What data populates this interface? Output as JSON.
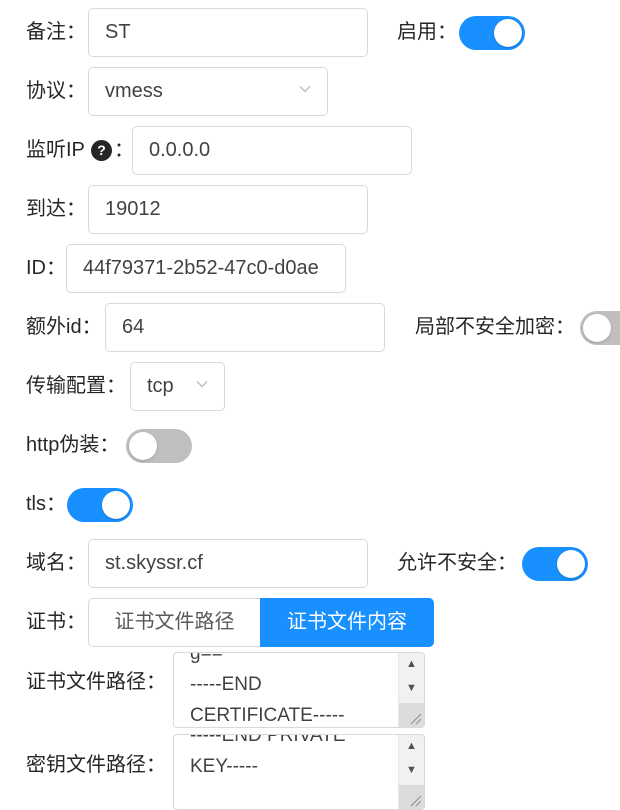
{
  "remark": {
    "label": "备注：",
    "value": "ST"
  },
  "enable": {
    "label": "启用：",
    "on": true
  },
  "protocol": {
    "label": "协议：",
    "value": "vmess"
  },
  "listen_ip": {
    "label_prefix": "监听IP",
    "label_suffix": "：",
    "help_icon": "question-circle-icon",
    "help_glyph": "?",
    "value": "0.0.0.0"
  },
  "port": {
    "label": "到达：",
    "value": "19012"
  },
  "id_field": {
    "label": "ID：",
    "value": "44f79371-2b52-47c0-d0ae"
  },
  "alter_id": {
    "label": "额外id：",
    "value": "64"
  },
  "partial_insecure": {
    "label": "局部不安全加密：",
    "on": false
  },
  "transport": {
    "label": "传输配置：",
    "value": "tcp"
  },
  "http_disguise": {
    "label": "http伪装：",
    "on": false
  },
  "tls": {
    "label": "tls：",
    "on": true
  },
  "domain": {
    "label": "域名：",
    "value": "st.skyssr.cf"
  },
  "allow_insecure": {
    "label": "允许不安全：",
    "on": true
  },
  "cert": {
    "label": "证书：",
    "options": [
      "证书文件路径",
      "证书文件内容"
    ],
    "selected": "证书文件内容"
  },
  "cert_file": {
    "label": "证书文件路径：",
    "lines": [
      "g==",
      "-----END",
      "CERTIFICATE-----"
    ]
  },
  "key_file": {
    "label": "密钥文件路径：",
    "lines": [
      "-----END PRIVATE",
      "KEY-----"
    ]
  },
  "icons": {
    "scroll_up": "▲",
    "scroll_down": "▼"
  },
  "colors": {
    "primary": "#1890ff",
    "switch_off": "#bfbfbf",
    "border": "#d9d9d9"
  }
}
